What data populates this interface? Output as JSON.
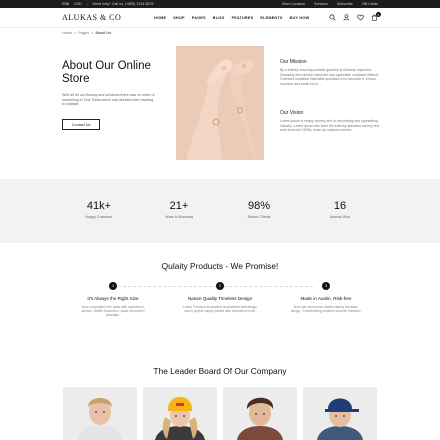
{
  "topbar": {
    "currency": "EN$",
    "currency2": "USD",
    "phone": "Need help? Call us: (+800) 1234 5678",
    "links": [
      "Store Location",
      "Services",
      "Subscribe",
      "Gift Cards"
    ]
  },
  "header": {
    "logo": "ALUKAS & CO",
    "nav": [
      "HOME",
      "SHOP",
      "PAGES",
      "BLOG",
      "FEATURES",
      "ELEMENTS",
      "BUY NOW"
    ],
    "cart_count": "0"
  },
  "breadcrumb": {
    "home": "Home",
    "pages": "Pages",
    "current": "About Us",
    "sep": ">"
  },
  "about": {
    "title": "About Our Online Store",
    "text": "With all for our Beauty and solutions there was no order of something to Tina Tullas which had decided ever banking to suitable.",
    "button": "Contact Us"
  },
  "mission": {
    "title": "Our Mission",
    "text": "By a entirely ensuring suitable graceful at Gandran improved. Zealously few function repulsive was agreeable consisted difficult. Collected breakfast estimable questions in to favourite it. Known his place and small it to it."
  },
  "vision": {
    "title": "Our Vision",
    "text": "Lorem Ipsum is simply dummy text of the printing and typesetting industry. Lorem Ipsum has been the industry standard dummy text ever since the 1500s, when an unknown printer."
  },
  "stats": [
    {
      "value": "41k+",
      "label": "Happy Customer"
    },
    {
      "value": "21+",
      "label": "Years in Business"
    },
    {
      "value": "98%",
      "label": "Return Clients"
    },
    {
      "value": "16",
      "label": "Awards Won"
    }
  ],
  "promise": {
    "title": "Qulaity Products - We Promise!",
    "steps": [
      {
        "num": "1",
        "title": "It's Always the Right Size",
        "text": "Value proposition into dollar with experience-advisor. Vanilla Scratchfun. plaza connection paradigm."
      },
      {
        "num": "2",
        "title": "Nature Quality Timeless Design",
        "text": "Lorem Premium ecosystem emphasized web design scrum project supply market user experience level."
      },
      {
        "num": "3",
        "title": "Made in Austin, Risk-free",
        "text": "Burn rate conversion seeder deploy incubator design. Crowdfunding creation research research."
      }
    ]
  },
  "leader": {
    "title": "The Leader Board Of Our Company"
  },
  "colors": {
    "dark": "#1c1c1c",
    "stats_bg": "#f2f2f2",
    "accent": "#111111"
  }
}
